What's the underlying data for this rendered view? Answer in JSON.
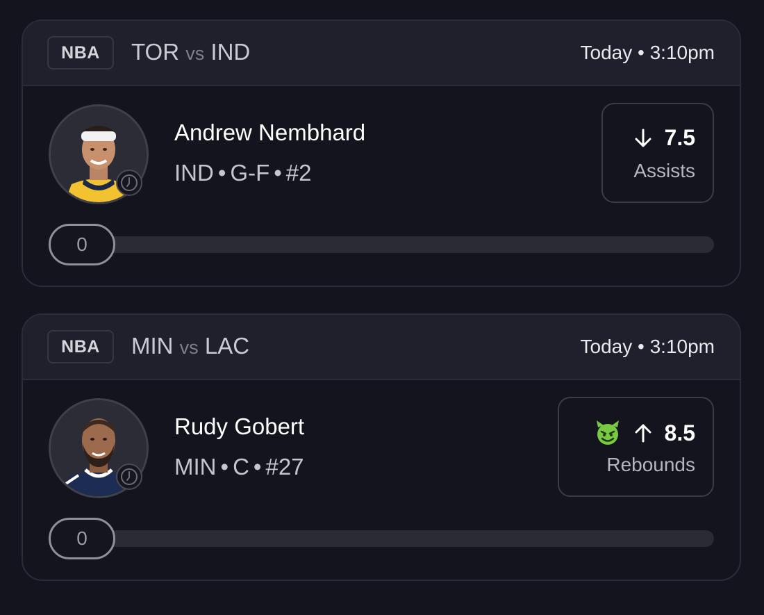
{
  "cards": [
    {
      "league": "NBA",
      "team_a": "TOR",
      "vs": "vs",
      "team_b": "IND",
      "time": "Today • 3:10pm",
      "player": {
        "name": "Andrew Nembhard",
        "team": "IND",
        "position": "G-F",
        "number": "#2",
        "jersey_color": "#f2c230"
      },
      "prop": {
        "direction": "down",
        "line": "7.5",
        "stat": "Assists",
        "emoji": null
      },
      "progress": {
        "current": "0",
        "fraction": 0
      }
    },
    {
      "league": "NBA",
      "team_a": "MIN",
      "vs": "vs",
      "team_b": "LAC",
      "time": "Today • 3:10pm",
      "player": {
        "name": "Rudy Gobert",
        "team": "MIN",
        "position": "C",
        "number": "#27",
        "jersey_color": "#1d2c52"
      },
      "prop": {
        "direction": "up",
        "line": "8.5",
        "stat": "Rebounds",
        "emoji": "smiling-devil-icon"
      },
      "progress": {
        "current": "0",
        "fraction": 0
      }
    }
  ],
  "colors": {
    "background": "#13141d",
    "header": "#1f202b",
    "border": "#2b2c38",
    "devil_green": "#7ac943"
  }
}
